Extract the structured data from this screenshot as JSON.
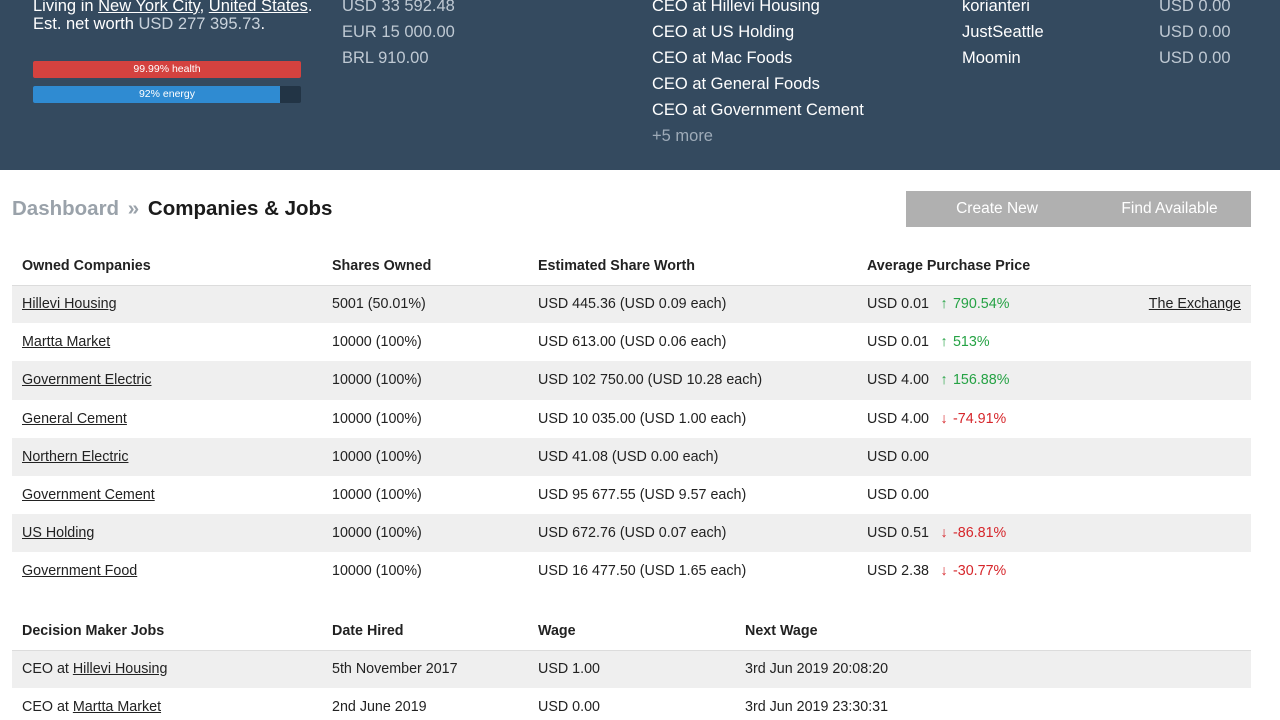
{
  "profile": {
    "living_prefix": "Living in ",
    "city": "New York City",
    "comma": ", ",
    "country": "United States",
    "period": ".",
    "networth_label": "Est. net worth ",
    "networth_value": "USD 277 395.73",
    "health_label": "99.99% health",
    "health_fraction": 0.9999,
    "energy_label": "92% energy",
    "energy_fraction": 0.92
  },
  "balances": [
    "USD 33 592.48",
    "EUR 15 000.00",
    "BRL 910.00"
  ],
  "positions": {
    "items": [
      "CEO at Hillevi Housing",
      "CEO at US Holding",
      "CEO at Mac Foods",
      "CEO at General Foods",
      "CEO at Government Cement"
    ],
    "more": "+5 more"
  },
  "people": {
    "names": [
      "korianteri",
      "JustSeattle",
      "Moomin"
    ],
    "amounts": [
      "USD 0.00",
      "USD 0.00",
      "USD 0.00"
    ]
  },
  "breadcrumb": {
    "root": "Dashboard",
    "sep": "»",
    "current": "Companies & Jobs"
  },
  "actions": {
    "create": "Create New Company",
    "find": "Find Available Jobs"
  },
  "companies": {
    "headers": [
      "Owned Companies",
      "Shares Owned",
      "Estimated Share Worth",
      "Average Purchase Price",
      ""
    ],
    "rows": [
      {
        "name": "Hillevi Housing",
        "shares": "5001 (50.01%)",
        "worth": "USD 445.36 (USD 0.09 each)",
        "price": "USD 0.01",
        "change": "790.54%",
        "dir": "up",
        "link": "The Exchange"
      },
      {
        "name": "Martta Market",
        "shares": "10000 (100%)",
        "worth": "USD 613.00 (USD 0.06 each)",
        "price": "USD 0.01",
        "change": "513%",
        "dir": "up",
        "link": ""
      },
      {
        "name": "Government Electric",
        "shares": "10000 (100%)",
        "worth": "USD 102 750.00 (USD 10.28 each)",
        "price": "USD 4.00",
        "change": "156.88%",
        "dir": "up",
        "link": ""
      },
      {
        "name": "General Cement",
        "shares": "10000 (100%)",
        "worth": "USD 10 035.00 (USD 1.00 each)",
        "price": "USD 4.00",
        "change": "-74.91%",
        "dir": "down",
        "link": ""
      },
      {
        "name": "Northern Electric",
        "shares": "10000 (100%)",
        "worth": "USD 41.08 (USD 0.00 each)",
        "price": "USD 0.00",
        "change": "",
        "dir": "",
        "link": ""
      },
      {
        "name": "Government Cement",
        "shares": "10000 (100%)",
        "worth": "USD 95 677.55 (USD 9.57 each)",
        "price": "USD 0.00",
        "change": "",
        "dir": "",
        "link": ""
      },
      {
        "name": "US Holding",
        "shares": "10000 (100%)",
        "worth": "USD 672.76 (USD 0.07 each)",
        "price": "USD 0.51",
        "change": "-86.81%",
        "dir": "down",
        "link": ""
      },
      {
        "name": "Government Food",
        "shares": "10000 (100%)",
        "worth": "USD 16 477.50 (USD 1.65 each)",
        "price": "USD 2.38",
        "change": "-30.77%",
        "dir": "down",
        "link": ""
      }
    ]
  },
  "jobs": {
    "headers": [
      "Decision Maker Jobs",
      "Date Hired",
      "Wage",
      "Next Wage"
    ],
    "rows": [
      {
        "prefix": "CEO at ",
        "company": "Hillevi Housing",
        "hired": "5th November 2017",
        "wage": "USD 1.00",
        "next": "3rd Jun 2019 20:08:20"
      },
      {
        "prefix": "CEO at ",
        "company": "Martta Market",
        "hired": "2nd June 2019",
        "wage": "USD 0.00",
        "next": "3rd Jun 2019 23:30:31"
      }
    ]
  },
  "icons": {
    "up": "arrow-up-icon",
    "down": "arrow-down-icon"
  },
  "colors": {
    "header_bg": "#344a5f",
    "health": "#d4423f",
    "energy": "#2f8bd2",
    "up": "#25a244",
    "down": "#d6262b",
    "button_bg": "#b0b0b0"
  }
}
